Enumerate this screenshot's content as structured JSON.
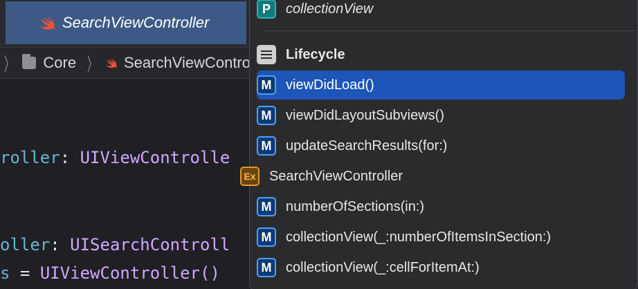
{
  "tab": {
    "title": "SearchViewController",
    "icon": "swift-icon"
  },
  "jumpbar": {
    "folder_name": "Core",
    "file_name": "SearchViewContro"
  },
  "code_lines": [
    {
      "a": "roller",
      "b": ": ",
      "c": "UIViewControlle"
    },
    {
      "a": "oller",
      "b": ": ",
      "c": "UISearchControll"
    },
    {
      "a": "s",
      "b": " = ",
      "c": "UIViewController()"
    }
  ],
  "menu": {
    "items": [
      {
        "badge": "P",
        "label": "collectionView",
        "kind": "property"
      },
      {
        "badge": "",
        "label": "Lifecycle",
        "kind": "mark"
      },
      {
        "badge": "M",
        "label": "viewDidLoad()",
        "kind": "method",
        "selected": true
      },
      {
        "badge": "M",
        "label": "viewDidLayoutSubviews()",
        "kind": "method"
      },
      {
        "badge": "M",
        "label": "updateSearchResults(for:)",
        "kind": "method"
      },
      {
        "badge": "Ex",
        "label": "SearchViewController",
        "kind": "extension"
      },
      {
        "badge": "M",
        "label": "numberOfSections(in:)",
        "kind": "method"
      },
      {
        "badge": "M",
        "label": "collectionView(_:numberOfItemsInSection:)",
        "kind": "method"
      },
      {
        "badge": "M",
        "label": "collectionView(_:cellForItemAt:)",
        "kind": "method"
      }
    ]
  },
  "colors": {
    "selection": "#1d55b8",
    "tab_active": "#3c5a85",
    "swift_orange": "#f05138",
    "type_purple": "#d0a8ff",
    "identifier_blue": "#67b7d1"
  }
}
